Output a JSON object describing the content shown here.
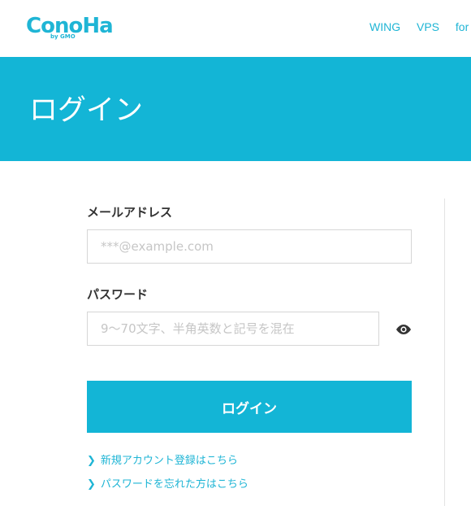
{
  "header": {
    "logo": {
      "brand": "ConoHa",
      "sub": "by GMO"
    },
    "nav": [
      "WING",
      "VPS",
      "for C"
    ]
  },
  "banner": {
    "title": "ログイン"
  },
  "form": {
    "email": {
      "label": "メールアドレス",
      "placeholder": "***@example.com",
      "value": ""
    },
    "password": {
      "label": "パスワード",
      "placeholder": "9〜70文字、半角英数と記号を混在",
      "value": "",
      "toggle_icon": "eye-icon"
    },
    "submit_label": "ログイン",
    "links": [
      {
        "text": "新規アカウント登録はこちら",
        "icon": "chevron-right-icon"
      },
      {
        "text": "パスワードを忘れた方はこちら",
        "icon": "chevron-right-icon"
      }
    ]
  },
  "colors": {
    "accent": "#13b5d6",
    "link": "#1fb5d5"
  }
}
